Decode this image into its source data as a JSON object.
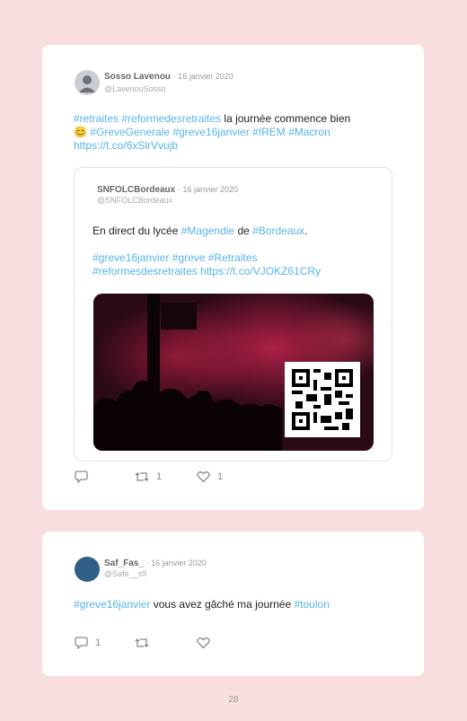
{
  "tweet1": {
    "name": "Sosso Lavenou",
    "date": "· 16 janvier 2020",
    "handle": "@LavenouSosso",
    "text_line1_tags": "#retraites #reformedesretraites",
    "text_line1_rest": " la journée commence bien",
    "emoji": "😊",
    "text_line2_tags": " #GreveGenerale #greve16janvier #IREM #Macron",
    "text_line3_link": "https://t.co/6xSlrVvujb",
    "quote": {
      "name": "SNFOLCBordeaux",
      "date": "· 16 janvier 2020",
      "handle": "@SNFOLCBordeaux",
      "line1_a": "En direct du lycée ",
      "line1_tag1": "#Magendie",
      "line1_b": " de ",
      "line1_tag2": "#Bordeaux",
      "line1_c": ".",
      "line2_tags": "#greve16janvier #greve #Retraites",
      "line3_tags": "#reformesdesretraites",
      "line3_link": " https://t.co/VJOKZ61CRy"
    },
    "retweets": "1",
    "likes": "1"
  },
  "tweet2": {
    "name": "Saf_Fas_",
    "date": "· 16 janvier 2020",
    "handle": "@Safe__s9",
    "tag1": "#greve16janvier",
    "text": " vous avez gâché ma journée ",
    "tag2": "#toulon",
    "replies": "1"
  },
  "page_number": "28",
  "colors": {
    "background": "#f8dede",
    "hashtag": "#58b4e8",
    "card": "#ffffff"
  }
}
